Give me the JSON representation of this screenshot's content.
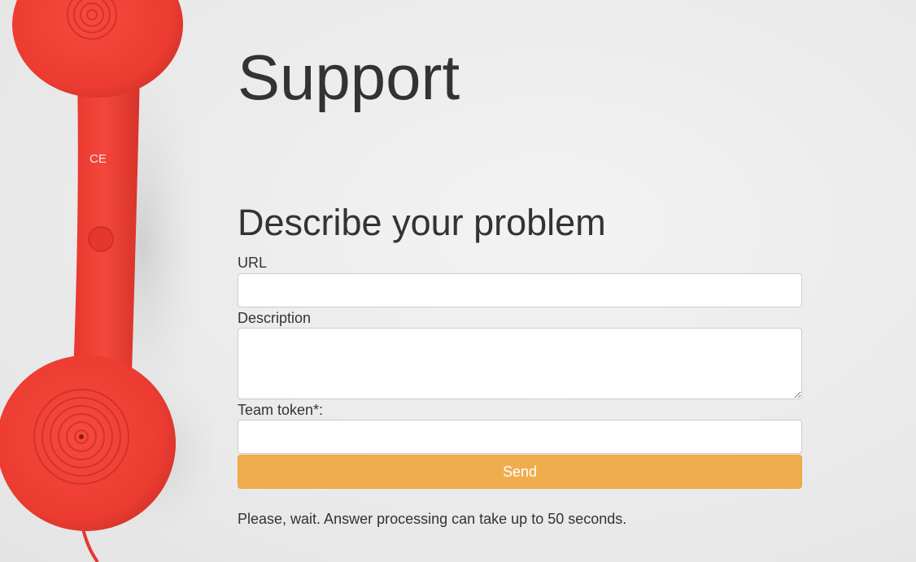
{
  "page": {
    "title": "Support",
    "form_heading": "Describe your problem"
  },
  "form": {
    "url_label": "URL",
    "url_value": "",
    "description_label": "Description",
    "description_value": "",
    "token_label": "Team token*:",
    "token_value": "",
    "send_label": "Send",
    "status_message": "Please, wait. Answer processing can take up to 50 seconds."
  },
  "colors": {
    "send_button": "#f0ad4e",
    "phone": "#ef4036",
    "text": "#333333"
  },
  "icons": {
    "background": "red-telephone-handset-image"
  }
}
